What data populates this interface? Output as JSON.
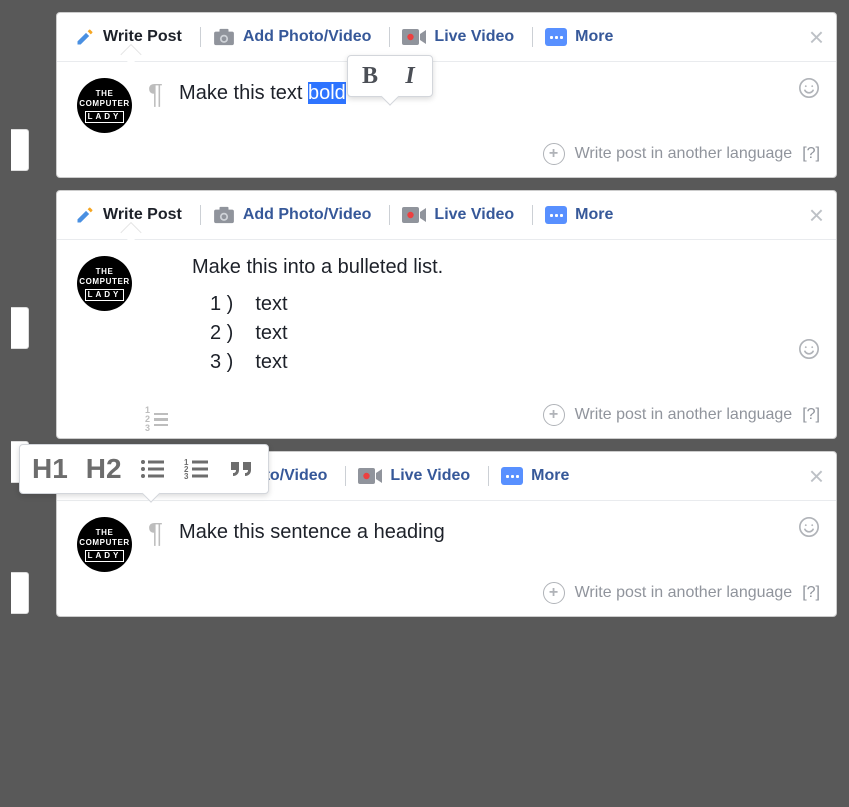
{
  "tabs": {
    "write": "Write Post",
    "photo": "Add Photo/Video",
    "live": "Live Video",
    "more": "More"
  },
  "avatar": {
    "line1": "THE",
    "line2": "COMPUTER",
    "line3": "LADY"
  },
  "footer": {
    "langText": "Write post in another language",
    "help": "[?]"
  },
  "card1": {
    "textPrefix": "Make this text ",
    "textSelected": "bold",
    "popover": {
      "bold": "B",
      "italic": "I"
    }
  },
  "card2": {
    "heading": "Make this into a bulleted list.",
    "items": [
      {
        "num": "1 )",
        "val": "text"
      },
      {
        "num": "2 )",
        "val": "text"
      },
      {
        "num": "3 )",
        "val": "text"
      }
    ]
  },
  "card3": {
    "text": "Make this sentence a heading",
    "popover": {
      "h1": "H1",
      "h2": "H2"
    }
  }
}
